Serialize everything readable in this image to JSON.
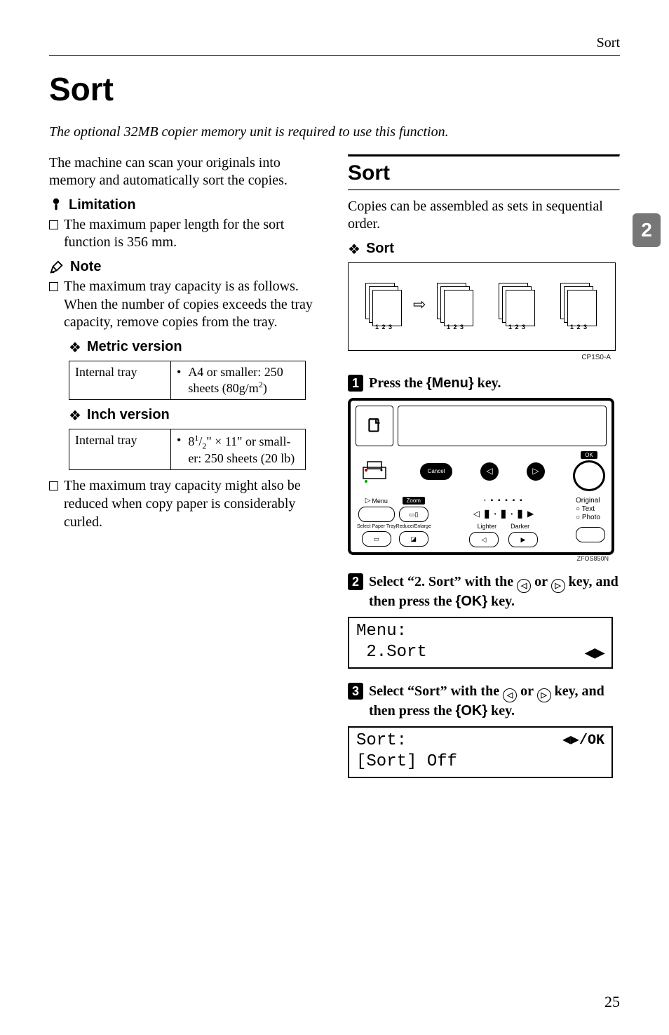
{
  "running_head": "Sort",
  "title": "Sort",
  "intro": "The optional 32MB copier memory unit is required to use this function.",
  "left": {
    "lead": "The machine can scan your originals into memory and automatically sort the copies.",
    "limitation_label": "Limitation",
    "limitation_items": [
      "The maximum paper length for the sort function is 356 mm."
    ],
    "note_label": "Note",
    "note_item_1": "The maximum tray capacity is as follows. When the number of copies exceeds the tray capacity, remove copies from the tray.",
    "metric_label": "Metric version",
    "metric_table": {
      "col1": "Internal tray",
      "col2_line1": "A4 or smaller: 250",
      "col2_line2": "sheets (80g/m",
      "col2_sup": "2",
      "col2_line2_end": ")"
    },
    "inch_label": "Inch version",
    "inch_table": {
      "col1": "Internal tray",
      "col2": "8",
      "col2_sup1": "1",
      "col2_slash": "/",
      "col2_sub": "2",
      "col2_rest1": "\" × 11\" or small-",
      "col2_rest2": "er: 250 sheets (20 lb)"
    },
    "note_item_2": "The maximum tray capacity might also be reduced when copy paper is considerably curled."
  },
  "right": {
    "heading": "Sort",
    "lead": "Copies can be assembled as sets in sequential order.",
    "sort_label": "Sort",
    "diagram_caption": "CP1S0-A",
    "step1_pre": "Press the ",
    "step1_key": "Menu",
    "step1_post": " key.",
    "panel_caption": "ZFOS850N",
    "panel": {
      "cancel": "Cancel",
      "ok": "OK",
      "menu": "Menu",
      "zoom": "Zoom",
      "select_paper": "Select Paper Tray",
      "reduce": "Reduce/Enlarge",
      "lighter": "Lighter",
      "darker": "Darker",
      "original": "Original",
      "otext": "Text",
      "ophoto": "Photo"
    },
    "step2": {
      "pre": "Select “2. Sort” with the ",
      "mid": " or ",
      "post1": " key, and then press the ",
      "key": "OK",
      "post2": " key."
    },
    "lcd1_line1": "Menu:",
    "lcd1_line2": " 2.Sort",
    "step3": {
      "pre": "Select “Sort” with the ",
      "mid": " or ",
      "post1": " key, and then press the ",
      "key": "OK",
      "post2": " key."
    },
    "lcd2_line1": "Sort:",
    "lcd2_ok": "/OK",
    "lcd2_line2": "[Sort] Off"
  },
  "side_tab": "2",
  "page_number": "25",
  "icons": {
    "limitation": "limitation-icon",
    "note": "pencil-icon",
    "diamond": "diamond-icon",
    "left_arrow": "◁",
    "right_arrow": "▷",
    "doc_icon": "🗎"
  }
}
